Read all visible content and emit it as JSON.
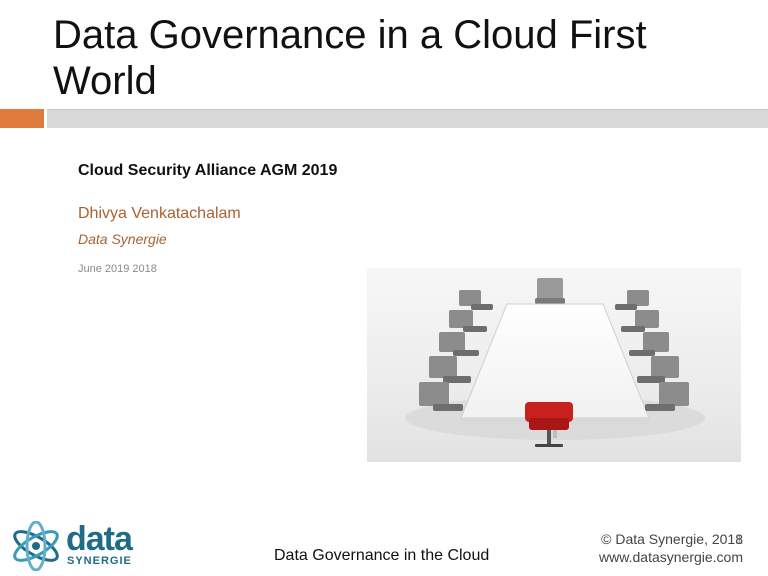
{
  "slide": {
    "title": "Data Governance in a Cloud First World",
    "event": "Cloud Security Alliance AGM 2019",
    "author": "Dhivya Venkatachalam",
    "organization": "Data Synergie",
    "date": "June 2019 2018"
  },
  "logo": {
    "word": "data",
    "subword": "SYNERGIE"
  },
  "footer": {
    "title": "Data Governance in the Cloud",
    "copyright": "© Data Synergie, 2018",
    "page_number": "1",
    "website": "www.datasynergie.com"
  },
  "colors": {
    "accent": "#e07b3e",
    "author_text": "#a86232",
    "logo_blue": "#1f6b88",
    "chair_red": "#c8201f"
  }
}
